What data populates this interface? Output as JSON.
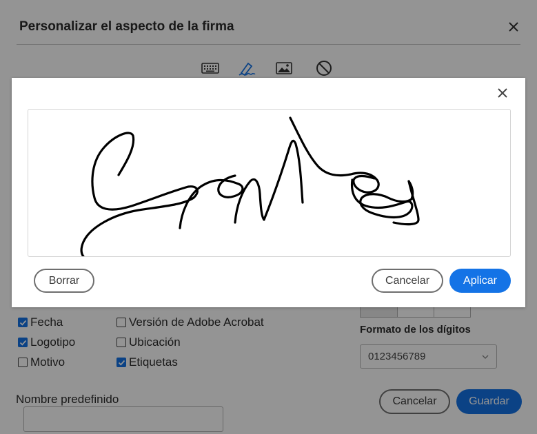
{
  "dialog": {
    "title": "Personalizar el aspecto de la firma",
    "modes": [
      "keyboard-icon",
      "pen-signature-icon",
      "image-icon",
      "none-icon"
    ],
    "options": {
      "fecha": {
        "label": "Fecha",
        "checked": true
      },
      "logotipo": {
        "label": "Logotipo",
        "checked": true
      },
      "motivo": {
        "label": "Motivo",
        "checked": false
      },
      "version": {
        "label": "Versión de Adobe Acrobat",
        "checked": false
      },
      "ubicacion": {
        "label": "Ubicación",
        "checked": false
      },
      "etiquetas": {
        "label": "Etiquetas",
        "checked": true
      }
    },
    "digits_label": "Formato de los dígitos",
    "digits_value": "0123456789",
    "name_label": "Nombre predefinido",
    "name_value": "",
    "cancel_label": "Cancelar",
    "save_label": "Guardar"
  },
  "draw_modal": {
    "clear_label": "Borrar",
    "cancel_label": "Cancelar",
    "apply_label": "Aplicar"
  },
  "colors": {
    "accent": "#1473e6",
    "overlay": "#00000069",
    "ink": "#000000"
  }
}
